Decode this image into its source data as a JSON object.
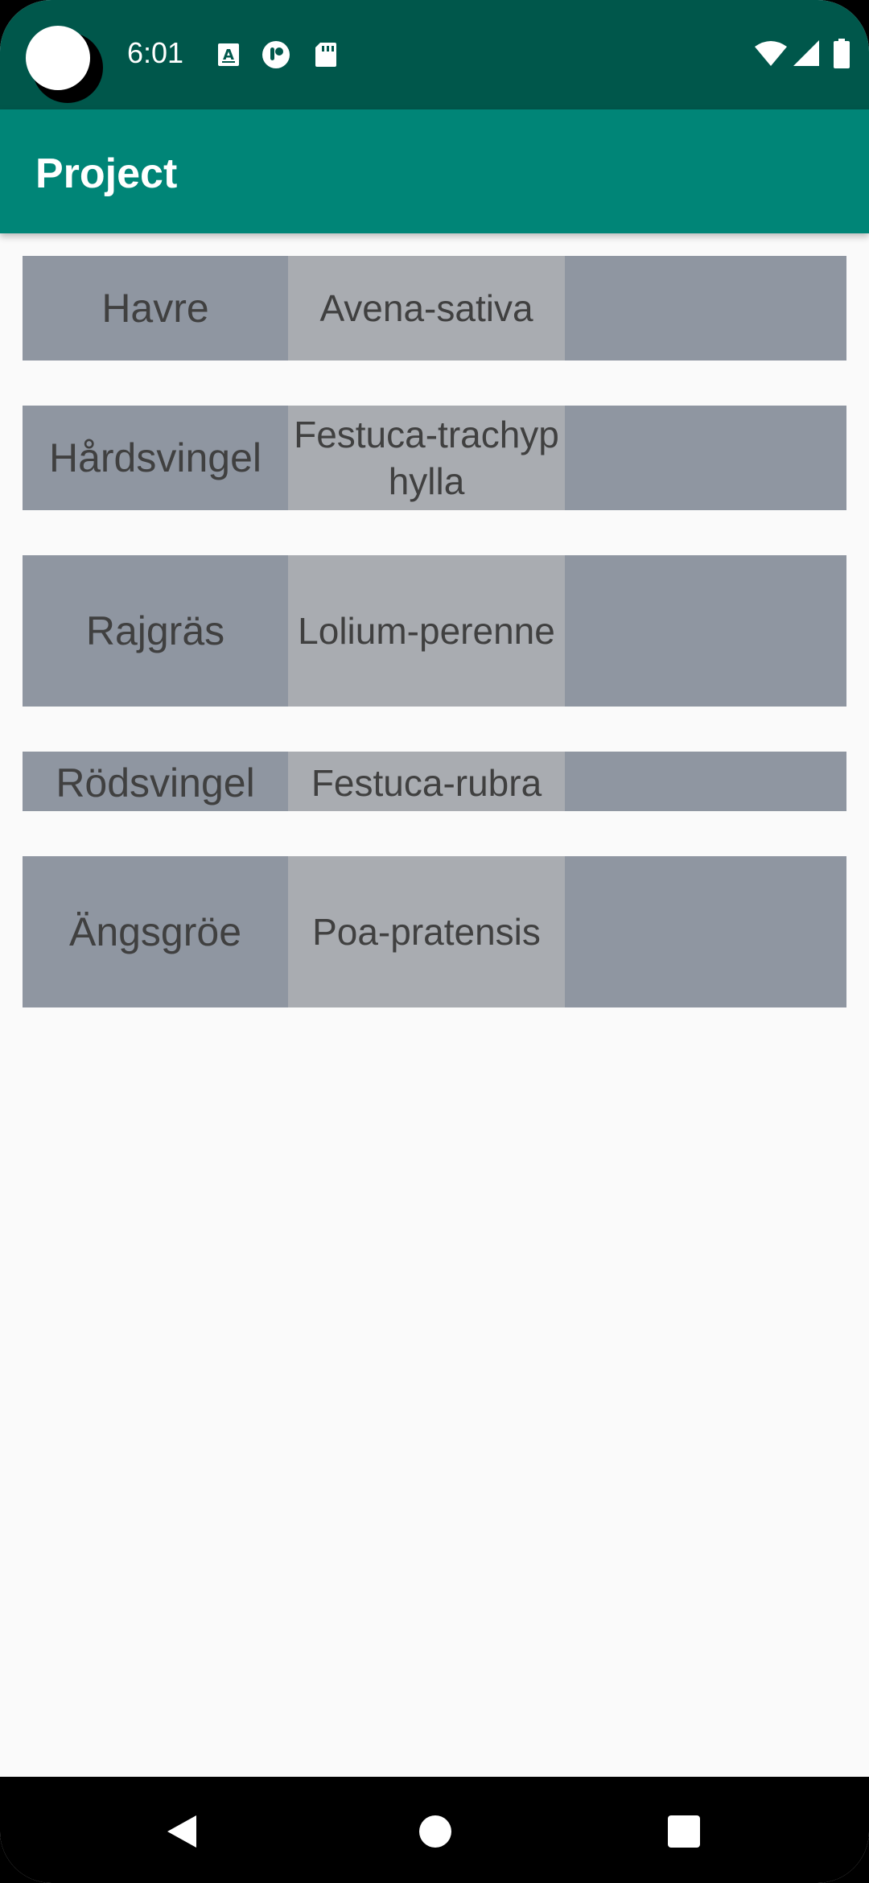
{
  "status_bar": {
    "time": "6:01",
    "icons": [
      "a-keyboard-icon",
      "circle-app-icon",
      "sd-card-icon",
      "wifi-icon",
      "signal-icon",
      "battery-icon"
    ]
  },
  "app_bar": {
    "title": "Project"
  },
  "list": {
    "items": [
      {
        "common": "Havre",
        "latin": "Avena-sativa",
        "extra": ""
      },
      {
        "common": "Hårdsvingel",
        "latin": "Festuca-trachyphylla",
        "extra": ""
      },
      {
        "common": "Rajgräs",
        "latin": "Lolium-perenne",
        "extra": ""
      },
      {
        "common": "Rödsvingel",
        "latin": "Festuca-rubra",
        "extra": ""
      },
      {
        "common": "Ängsgröe",
        "latin": "Poa-pratensis",
        "extra": ""
      }
    ]
  },
  "nav_bar": {
    "icons": [
      "back-icon",
      "home-icon",
      "recents-icon"
    ]
  },
  "colors": {
    "status_bar": "#00574b",
    "app_bar": "#008577",
    "cell_dark": "#8f96a1",
    "cell_light": "#a9acb1",
    "background": "#fafafa"
  }
}
